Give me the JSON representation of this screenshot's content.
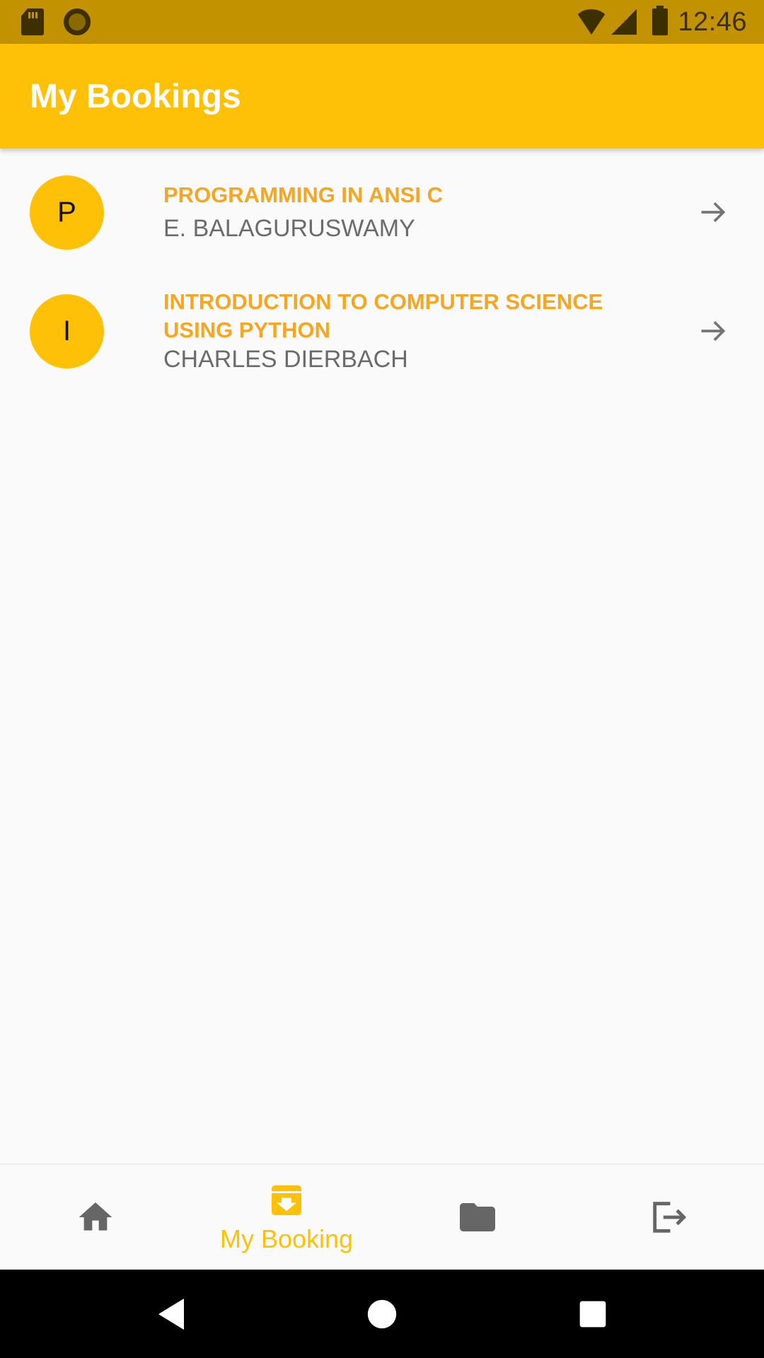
{
  "status_bar": {
    "time": "12:46"
  },
  "app_bar": {
    "title": "My Bookings"
  },
  "bookings": [
    {
      "avatar_letter": "P",
      "title": "PROGRAMMING IN ANSI C",
      "author": "E. BALAGURUSWAMY"
    },
    {
      "avatar_letter": "I",
      "title": "INTRODUCTION TO COMPUTER SCIENCE USING PYTHON",
      "author": "CHARLES DIERBACH"
    }
  ],
  "bottom_nav": {
    "items": [
      {
        "icon": "home-icon",
        "label": ""
      },
      {
        "icon": "archive-download-icon",
        "label": "My Booking",
        "active": true
      },
      {
        "icon": "folder-icon",
        "label": ""
      },
      {
        "icon": "logout-icon",
        "label": ""
      }
    ]
  },
  "colors": {
    "status_bar": "#c29200",
    "app_bar": "#ffc107",
    "accent_text": "#f5a623",
    "secondary_text": "#6b6b6b",
    "nav_inactive": "#666666"
  }
}
